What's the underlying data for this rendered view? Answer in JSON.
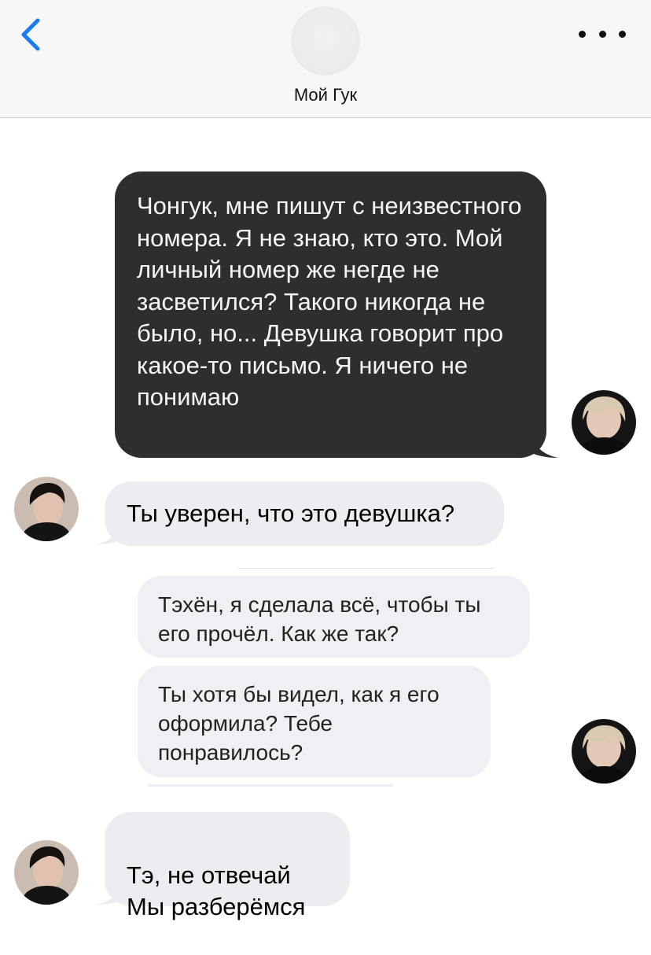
{
  "header": {
    "contact_name": "Мой Гук",
    "back_icon": "chevron-left-icon",
    "more_icon": "ellipsis-icon",
    "accent_color": "#1a7cf5"
  },
  "messages": [
    {
      "side": "right",
      "style": "dark",
      "text": "Чонгук, мне пишут с неизвестного номера. Я не знаю, кто это. Мой личный номер же негде не засветился? Такого никогда не было, но... Девушка говорит про какое-то письмо. Я ничего не понимаю"
    },
    {
      "side": "left",
      "style": "light",
      "text": "Ты уверен, что это девушка?"
    },
    {
      "side": "right",
      "style": "pale",
      "text": "Тэхён, я сделала всё, чтобы ты его прочёл. Как же так?"
    },
    {
      "side": "right",
      "style": "pale",
      "text": "Ты хотя бы видел, как я его оформила? Тебе понравилось?"
    },
    {
      "side": "left",
      "style": "light",
      "text": "Тэ, не отвечай\nМы разберёмся"
    }
  ],
  "colors": {
    "dark_bubble": "#2e2e2e",
    "light_bubble": "#ececf1",
    "pale_bubble": "#f0f0f4"
  }
}
